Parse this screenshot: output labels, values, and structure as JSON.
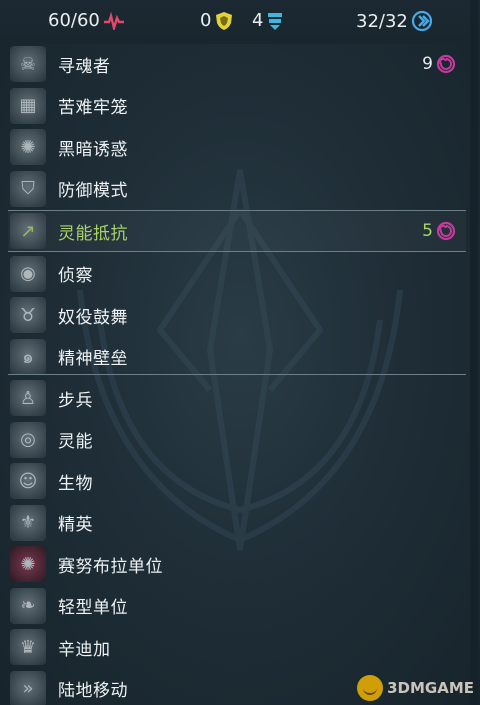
{
  "topbar": {
    "health": "60/60",
    "shield": "0",
    "armor": "4",
    "energy": "32/32"
  },
  "rows": [
    {
      "label": "寻魂者",
      "value": "9",
      "icon": "soul-seeker-icon"
    },
    {
      "label": "苦难牢笼",
      "value": "",
      "icon": "cage-icon"
    },
    {
      "label": "黑暗诱惑",
      "value": "",
      "icon": "dark-lure-icon"
    },
    {
      "label": "防御模式",
      "value": "",
      "icon": "defense-shield-icon"
    },
    {
      "label": "灵能抵抗",
      "value": "5",
      "icon": "psionic-resist-icon"
    },
    {
      "label": "侦察",
      "value": "",
      "icon": "eye-icon"
    },
    {
      "label": "奴役鼓舞",
      "value": "",
      "icon": "demon-icon"
    },
    {
      "label": "精神壁垒",
      "value": "",
      "icon": "spiral-icon"
    },
    {
      "label": "步兵",
      "value": "",
      "icon": "infantry-icon"
    },
    {
      "label": "灵能",
      "value": "",
      "icon": "psionic-icon"
    },
    {
      "label": "生物",
      "value": "",
      "icon": "biological-icon"
    },
    {
      "label": "精英",
      "value": "",
      "icon": "elite-icon"
    },
    {
      "label": "赛努布拉单位",
      "value": "",
      "icon": "zerg-icon"
    },
    {
      "label": "轻型单位",
      "value": "",
      "icon": "light-unit-icon"
    },
    {
      "label": "辛迪加",
      "value": "",
      "icon": "syndicate-icon"
    },
    {
      "label": "陆地移动",
      "value": "",
      "icon": "ground-move-icon"
    }
  ],
  "watermark": "3DMGAME",
  "colors": {
    "highlight": "#a9d26b",
    "health": "#e0496b",
    "shield": "#e3d23a",
    "armor": "#3fb6dd",
    "energy": "#47a9e6",
    "psionic": "#c23b9b"
  }
}
